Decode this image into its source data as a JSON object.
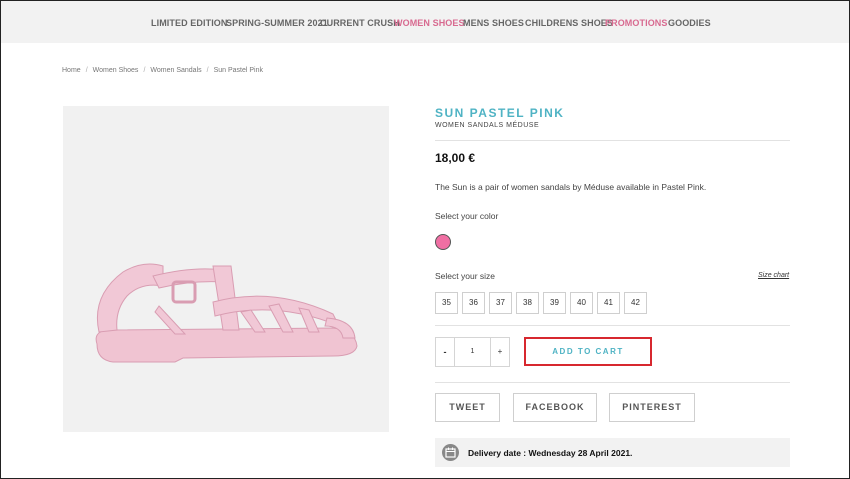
{
  "nav": {
    "items": [
      {
        "label": "LIMITED EDITION"
      },
      {
        "label": "SPRING-SUMMER 2021"
      },
      {
        "label": "CURRENT CRUSH"
      },
      {
        "label": "WOMEN SHOES"
      },
      {
        "label": "MENS SHOES"
      },
      {
        "label": "CHILDRENS SHOES"
      },
      {
        "label": "PROMOTIONS"
      },
      {
        "label": "GOODIES"
      }
    ]
  },
  "breadcrumb": {
    "items": [
      "Home",
      "Women Shoes",
      "Women Sandals",
      "Sun Pastel Pink"
    ],
    "separator": "/"
  },
  "product": {
    "title": "SUN PASTEL PINK",
    "subtitle": "WOMEN SANDALS MÉDUSE",
    "price": "18,00 €",
    "description": "The Sun  is a pair of women sandals by Méduse available in Pastel Pink.",
    "color_label": "Select your color",
    "color_swatch": "#f06fa3",
    "size_label": "Select your size",
    "size_chart_link": "Size chart",
    "sizes": [
      "35",
      "36",
      "37",
      "38",
      "39",
      "40",
      "41",
      "42"
    ]
  },
  "cart": {
    "minus": "-",
    "quantity": "1",
    "plus": "+",
    "add_to_cart": "ADD TO CART"
  },
  "share": {
    "tweet": "TWEET",
    "facebook": "FACEBOOK",
    "pinterest": "PINTEREST"
  },
  "delivery": {
    "text": "Delivery date : Wednesday 28 April 2021."
  },
  "colors": {
    "accent_teal": "#4fb3c4",
    "accent_pink": "#d86a90",
    "highlight_border": "#d7282f"
  }
}
